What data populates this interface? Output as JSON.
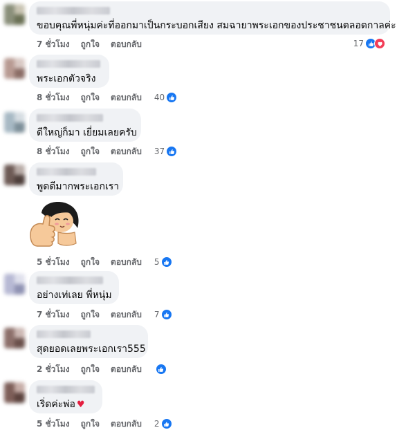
{
  "colors": {
    "bubble_bg": "#f0f2f5",
    "meta_text": "#65676b",
    "like_blue": "#1877f2",
    "love_red": "#f33e58"
  },
  "actions": {
    "like_label": "ถูกใจ",
    "reply_label": "ตอบกลับ"
  },
  "comments": [
    {
      "text": "ขอบคุณพี่หนุ่มค่ะที่ออกมาเป็นกระบอกเสียง สมฉายาพระเอกของประชาชนตลอดกาลค่ะ",
      "time": "7 ชั่วโมง",
      "reaction_count": "17",
      "reactions": [
        "like-icon",
        "love-icon"
      ]
    },
    {
      "text": "พระเอกตัวจริง",
      "time": "8 ชั่วโมง",
      "reaction_count": "40",
      "reactions": [
        "like-icon"
      ]
    },
    {
      "text": "ดีใหญ่ก็มา เยี่ยมเลยครับ",
      "time": "8 ชั่วโมง",
      "reaction_count": "37",
      "reactions": [
        "like-icon"
      ]
    },
    {
      "text": "พูดดีมากพระเอกเรา",
      "time": "5 ชั่วโมง",
      "reaction_count": "5",
      "reactions": [
        "like-icon"
      ],
      "sticker": "thumbs-up-girl-sticker"
    },
    {
      "text": "อย่างเท่เลย พี่หนุ่ม",
      "time": "7 ชั่วโมง",
      "reaction_count": "7",
      "reactions": [
        "like-icon"
      ]
    },
    {
      "text": "สุดยอดเลยพระเอกเรา555",
      "time": "2 ชั่วโมง",
      "reaction_count": "",
      "reactions": [
        "like-icon"
      ]
    },
    {
      "text": "เริ่ดค่ะพ่อ",
      "time": "5 ชั่วโมง",
      "reaction_count": "2",
      "reactions": [
        "like-icon"
      ],
      "inline_emoji": "♥"
    }
  ]
}
